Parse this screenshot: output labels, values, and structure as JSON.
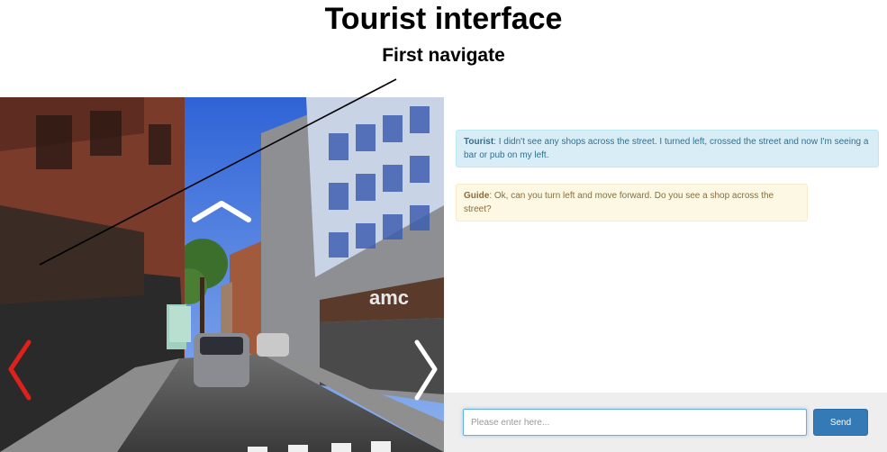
{
  "figure": {
    "title": "Tourist interface",
    "subtitle": "First navigate"
  },
  "street_view": {
    "nav_icons": {
      "up": "chevron-up-icon",
      "left": "chevron-left-icon",
      "right": "chevron-right-icon"
    },
    "colors": {
      "left_arrow_highlight": "#e0201a",
      "arrow": "#ffffff",
      "sky": "#3d6fd8"
    }
  },
  "chat": {
    "messages": [
      {
        "speaker": "Tourist",
        "separator": ": ",
        "text": "I didn't see any shops across the street. I turned left, crossed the street and now I'm seeing a bar or pub on my left."
      },
      {
        "speaker": "Guide",
        "separator": ": ",
        "text": "Ok, can you turn left and move forward. Do you see a shop across the street?"
      }
    ],
    "input": {
      "value": "",
      "placeholder": "Please enter here..."
    },
    "send_label": "Send",
    "colors": {
      "tourist_bg": "#d9edf7",
      "tourist_text": "#31708f",
      "guide_bg": "#fcf8e3",
      "guide_text": "#8a6d3b",
      "send_bg": "#337ab7"
    }
  }
}
